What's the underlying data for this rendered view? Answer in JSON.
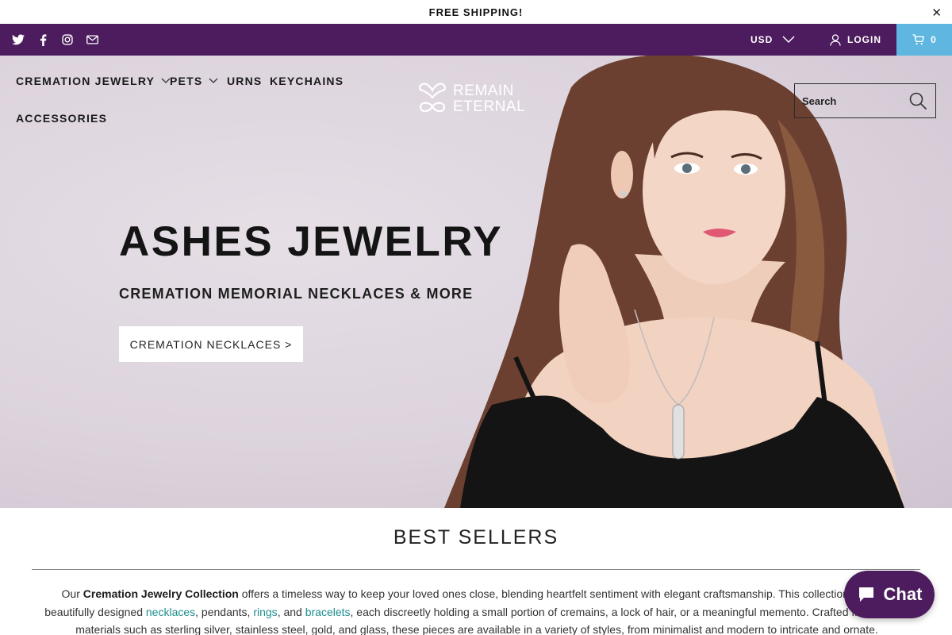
{
  "announcement": {
    "text": "FREE SHIPPING!",
    "close_label": "✕"
  },
  "topbar": {
    "social_icons": [
      "twitter-icon",
      "facebook-icon",
      "instagram-icon",
      "email-icon"
    ],
    "currency": "USD",
    "login": "LOGIN",
    "cart_count": "0",
    "colors": {
      "bar": "#4c1c5e",
      "cart": "#5fb6e0"
    }
  },
  "nav": {
    "items": [
      {
        "label": "CREMATION JEWELRY",
        "dropdown": true
      },
      {
        "label": "PETS",
        "dropdown": true
      },
      {
        "label": "URNS",
        "dropdown": false
      },
      {
        "label": "KEYCHAINS",
        "dropdown": false
      },
      {
        "label": "ACCESSORIES",
        "dropdown": false
      }
    ]
  },
  "logo": {
    "line1": "REMAIN",
    "line2": "ETERNAL"
  },
  "search": {
    "placeholder": "Search"
  },
  "hero": {
    "title": "ASHES JEWELRY",
    "subtitle": "CREMATION MEMORIAL NECKLACES & MORE",
    "button": "CREMATION NECKLACES >"
  },
  "best_sellers": {
    "title": "BEST SELLERS",
    "intro": {
      "p1": "Our ",
      "bold": "Cremation Jewelry Collection",
      "p2": " offers a timeless way to keep your loved ones close, blending heartfelt sentiment with elegant craftsmanship. This collection features beautifully designed ",
      "link1": "necklaces",
      "p3": ", pendants, ",
      "link2": "rings",
      "p4": ", and ",
      "link3": "bracelets",
      "p5": ", each discreetly holding a small portion of cremains, a lock of hair, or a meaningful memento. Crafted from quality materials such as sterling silver, stainless steel, gold, and glass, these pieces are available in a variety of styles, from minimalist and modern to intricate and ornate."
    }
  },
  "chat": {
    "label": "Chat"
  }
}
